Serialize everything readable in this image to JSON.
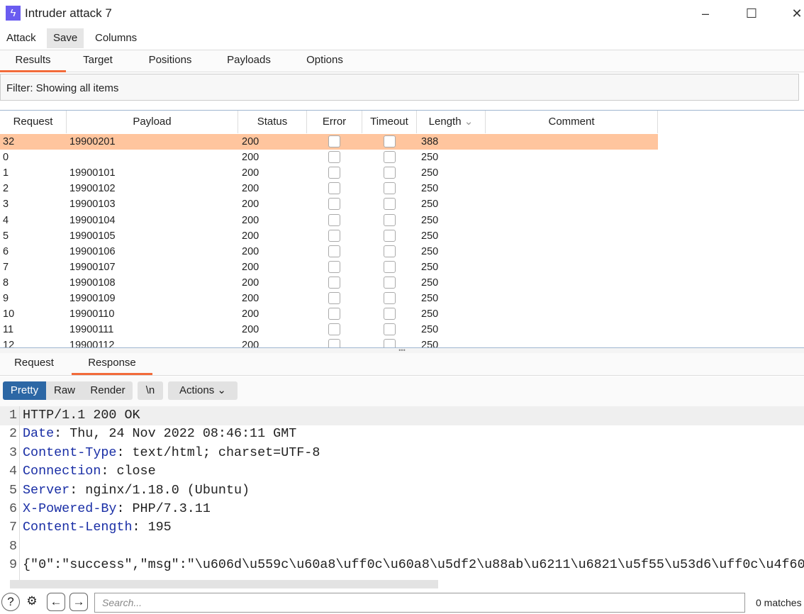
{
  "window": {
    "title": "Intruder attack 7",
    "minimize": "–",
    "maximize": "☐",
    "close": "✕"
  },
  "menu": [
    "Attack",
    "Save",
    "Columns"
  ],
  "tabs": [
    "Results",
    "Target",
    "Positions",
    "Payloads",
    "Options"
  ],
  "active_tab": "Results",
  "filter": "Filter: Showing all items",
  "table": {
    "columns": [
      "Request",
      "Payload",
      "Status",
      "Error",
      "Timeout",
      "Length",
      "Comment"
    ],
    "sorted_column": "Length",
    "rows": [
      [
        "32",
        "19900201",
        "200",
        false,
        false,
        "388",
        ""
      ],
      [
        "0",
        "",
        "200",
        false,
        false,
        "250",
        ""
      ],
      [
        "1",
        "19900101",
        "200",
        false,
        false,
        "250",
        ""
      ],
      [
        "2",
        "19900102",
        "200",
        false,
        false,
        "250",
        ""
      ],
      [
        "3",
        "19900103",
        "200",
        false,
        false,
        "250",
        ""
      ],
      [
        "4",
        "19900104",
        "200",
        false,
        false,
        "250",
        ""
      ],
      [
        "5",
        "19900105",
        "200",
        false,
        false,
        "250",
        ""
      ],
      [
        "6",
        "19900106",
        "200",
        false,
        false,
        "250",
        ""
      ],
      [
        "7",
        "19900107",
        "200",
        false,
        false,
        "250",
        ""
      ],
      [
        "8",
        "19900108",
        "200",
        false,
        false,
        "250",
        ""
      ],
      [
        "9",
        "19900109",
        "200",
        false,
        false,
        "250",
        ""
      ],
      [
        "10",
        "19900110",
        "200",
        false,
        false,
        "250",
        ""
      ],
      [
        "11",
        "19900111",
        "200",
        false,
        false,
        "250",
        ""
      ],
      [
        "12",
        "19900112",
        "200",
        false,
        false,
        "250",
        ""
      ]
    ],
    "selected_row": "32",
    "highlight_color": "#ffc59e"
  },
  "subtabs": [
    "Request",
    "Response"
  ],
  "active_subtab": "Response",
  "viewer": {
    "modes": [
      "Pretty",
      "Raw",
      "Render"
    ],
    "active_mode": "Pretty",
    "newline": "\\n",
    "actions": "Actions"
  },
  "response_lines": [
    {
      "n": "1",
      "key": "",
      "val": "HTTP/1.1 200 OK"
    },
    {
      "n": "2",
      "key": "Date",
      "val": ": Thu, 24 Nov 2022 08:46:11 GMT"
    },
    {
      "n": "3",
      "key": "Content-Type",
      "val": ": text/html; charset=UTF-8"
    },
    {
      "n": "4",
      "key": "Connection",
      "val": ": close"
    },
    {
      "n": "5",
      "key": "Server",
      "val": ": nginx/1.18.0 (Ubuntu)"
    },
    {
      "n": "6",
      "key": "X-Powered-By",
      "val": ": PHP/7.3.11"
    },
    {
      "n": "7",
      "key": "Content-Length",
      "val": ": 195"
    },
    {
      "n": "8",
      "key": "",
      "val": ""
    },
    {
      "n": "9",
      "key": "",
      "val": "{\"0\":\"success\",\"msg\":\"\\u606d\\u559c\\u60a8\\uff0c\\u60a8\\u5df2\\u88ab\\u6211\\u6821\\u5f55\\u53d6\\uff0c\\u4f60"
    }
  ],
  "bottom": {
    "search_placeholder": "Search...",
    "matches": "0 matches"
  },
  "accent": "#f26b3a",
  "button_active": "#2c67a5"
}
